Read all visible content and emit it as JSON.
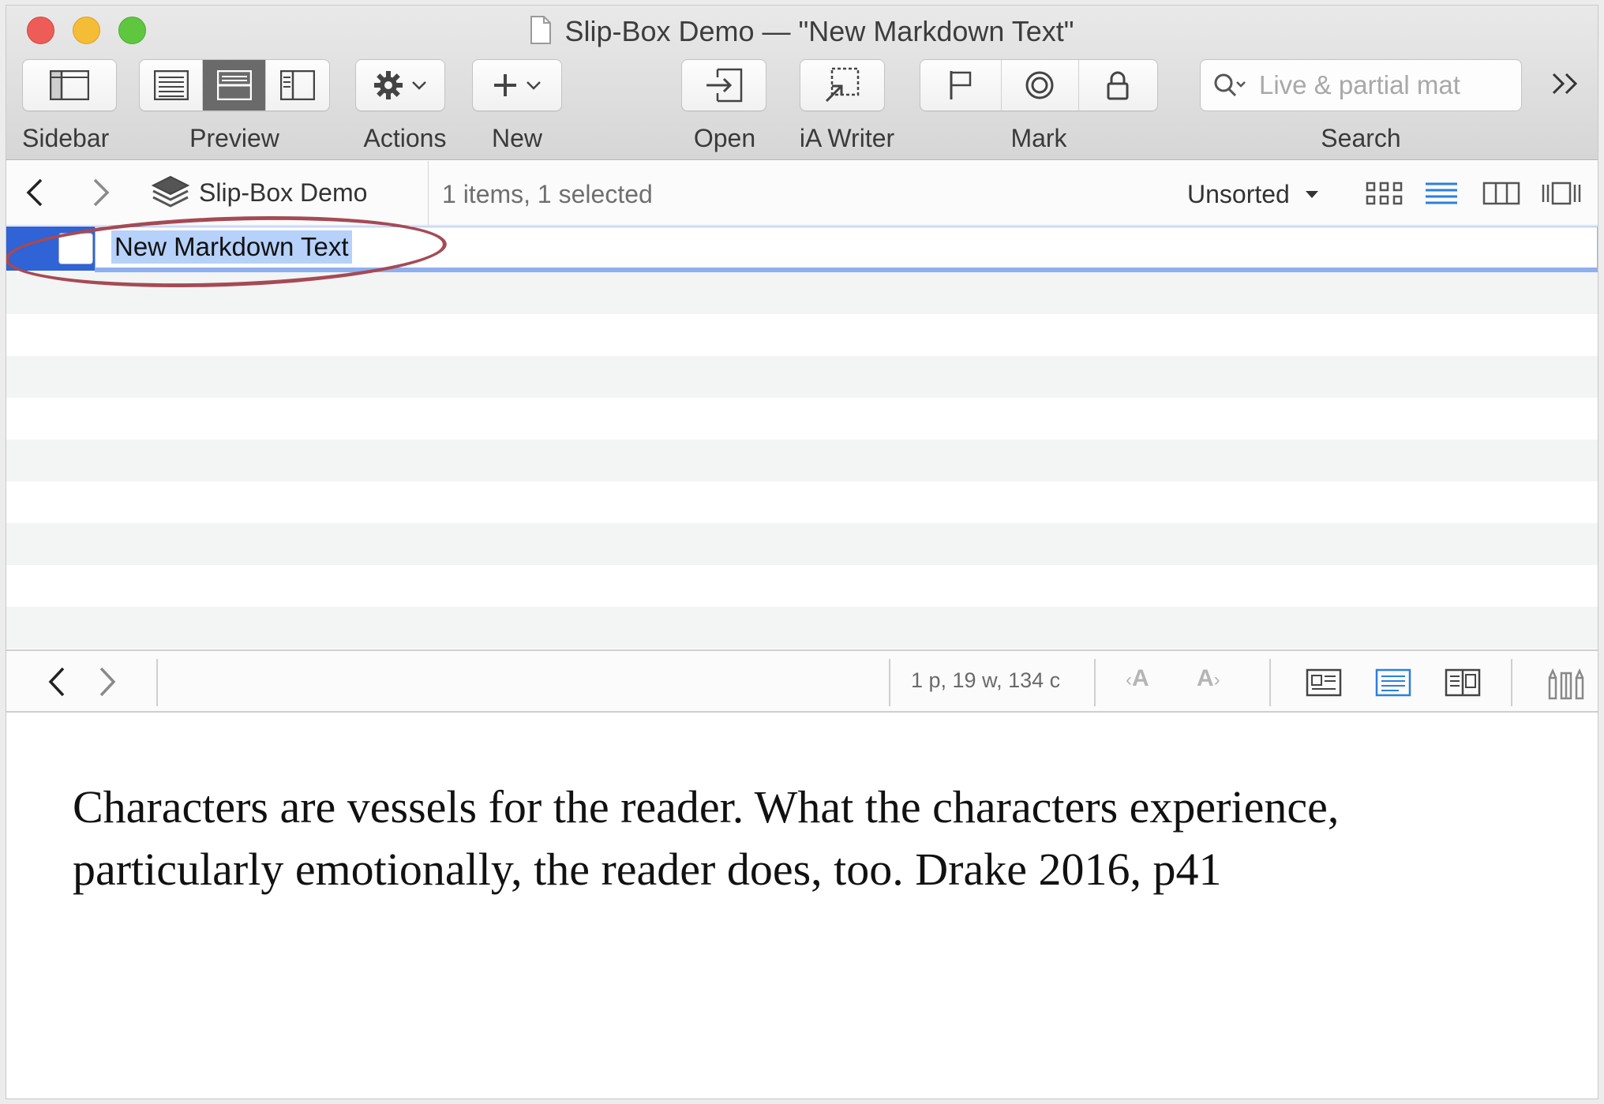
{
  "window": {
    "title": "Slip-Box Demo — \"New Markdown Text\"",
    "title_icon": "document-icon"
  },
  "toolbar": {
    "sidebar_label": "Sidebar",
    "preview_label": "Preview",
    "actions_label": "Actions",
    "new_label": "New",
    "open_label": "Open",
    "ia_writer_label": "iA Writer",
    "mark_label": "Mark",
    "search_label": "Search",
    "search_placeholder": "Live & partial mat",
    "overflow_glyph": "»",
    "preview_modes": [
      "list-only",
      "split-horizontal",
      "split-vertical"
    ],
    "preview_active": "split-horizontal"
  },
  "pathbar": {
    "library_name": "Slip-Box Demo",
    "items_count": "1 items, 1 selected",
    "sort_label": "Unsorted",
    "view_modes": [
      "icon-view",
      "list-view",
      "columns-view",
      "cover-flow-view"
    ],
    "view_active": "list-view"
  },
  "list": {
    "rows": [
      {
        "name": "New Markdown Text",
        "selected": true,
        "editing": true
      }
    ]
  },
  "statusbar": {
    "stats": "1 p, 19 w, 134 c",
    "font_smaller": "A",
    "font_larger": "A"
  },
  "preview": {
    "text": "Characters are vessels for the reader. What the characters experience, particularly emotionally, the reader does, too. Drake 2016, p41"
  },
  "colors": {
    "selection_blue": "#2f63d6",
    "text_highlight": "#b6d1fa",
    "accent_blue": "#2b7fe0",
    "annotation_ring": "#a54a55"
  }
}
